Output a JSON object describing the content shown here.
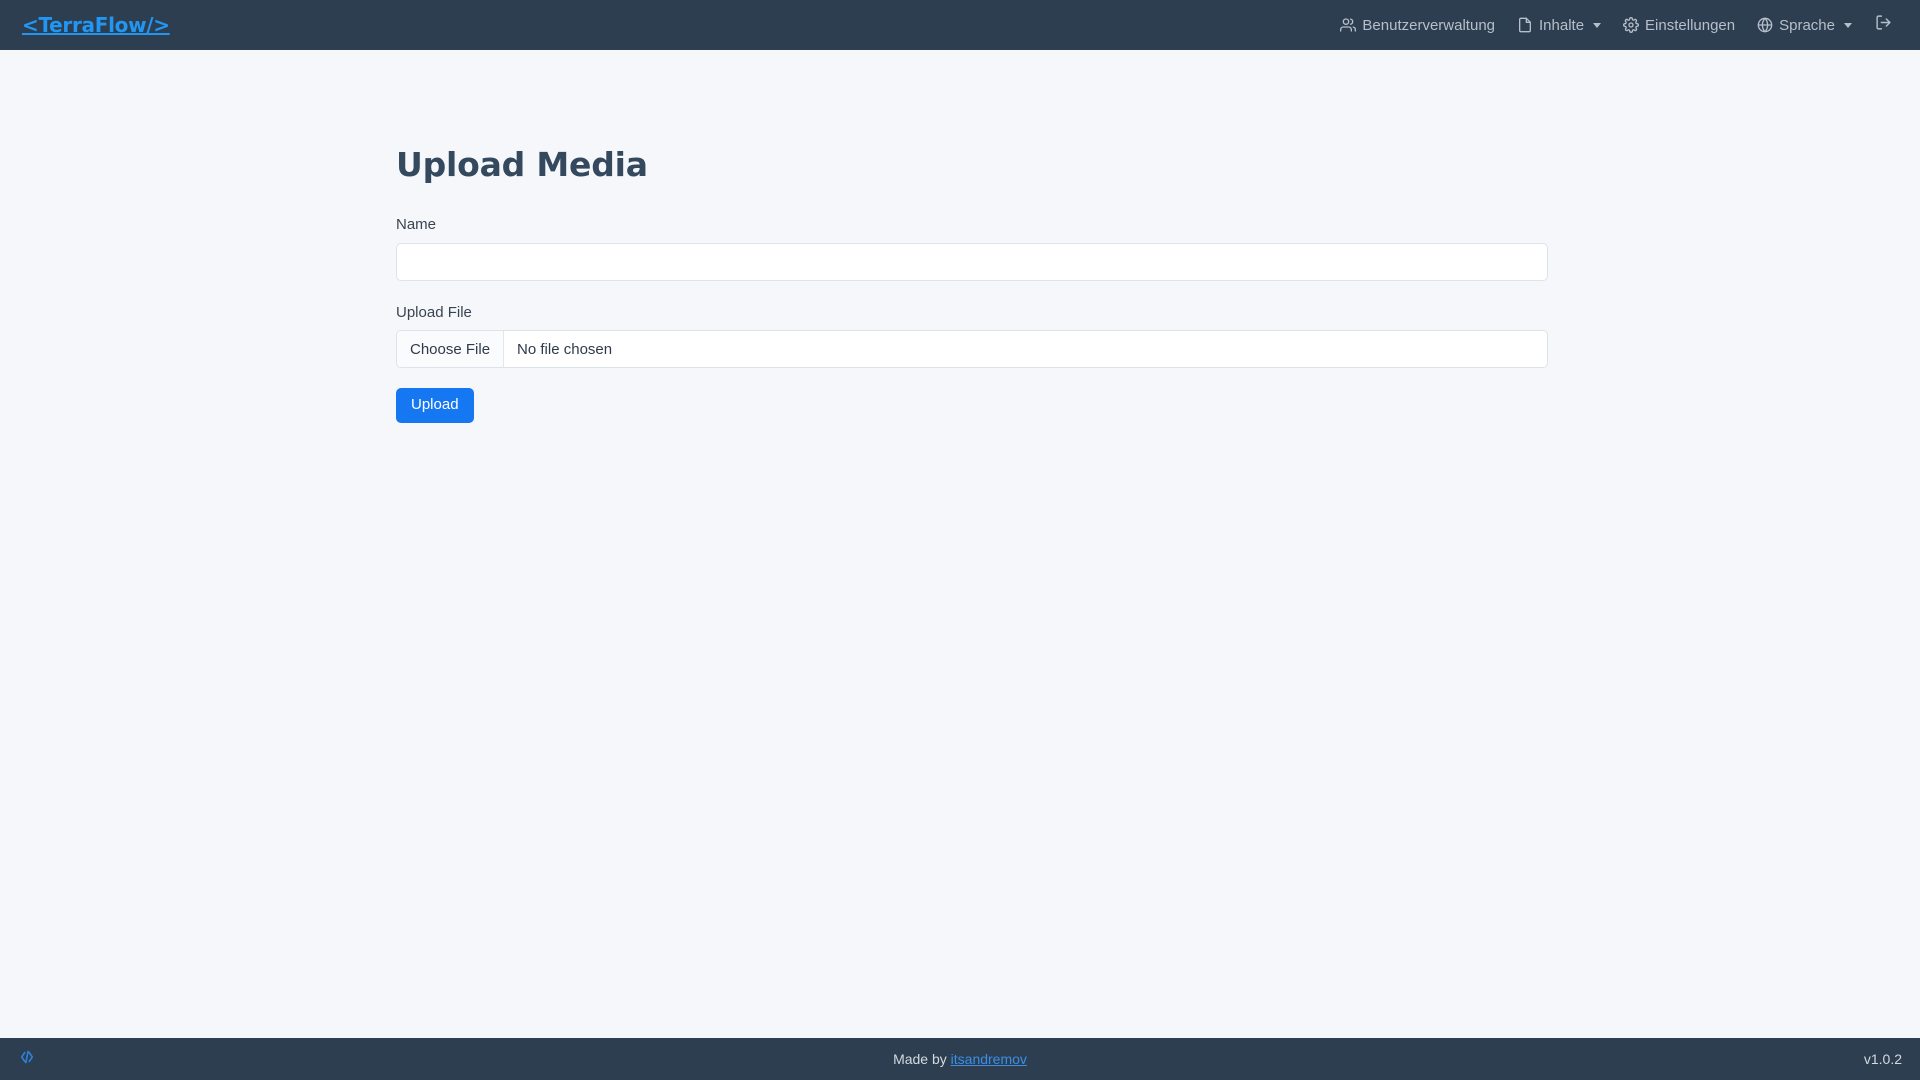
{
  "brand": {
    "logo_text": "<TerraFlow/>",
    "color": "#2196f3"
  },
  "navbar": {
    "background": "#2d3e50",
    "items": [
      {
        "label": "Benutzerverwaltung",
        "icon": "users-icon",
        "has_caret": false
      },
      {
        "label": "Inhalte",
        "icon": "document-icon",
        "has_caret": true
      },
      {
        "label": "Einstellungen",
        "icon": "gear-icon",
        "has_caret": false
      },
      {
        "label": "Sprache",
        "icon": "globe-icon",
        "has_caret": true
      }
    ],
    "logout_icon": "logout-icon"
  },
  "main": {
    "page_title": "Upload Media",
    "name_field": {
      "label": "Name",
      "value": "",
      "placeholder": ""
    },
    "file_field": {
      "label": "Upload File",
      "button_label": "Choose File",
      "status_text": "No file chosen"
    },
    "submit_button": {
      "label": "Upload",
      "color": "#1677f2"
    }
  },
  "footer": {
    "background": "#2d3e50",
    "code_icon": "code-icon",
    "made_by_prefix": "Made by ",
    "author": "itsandremov",
    "version": "v1.0.2"
  }
}
